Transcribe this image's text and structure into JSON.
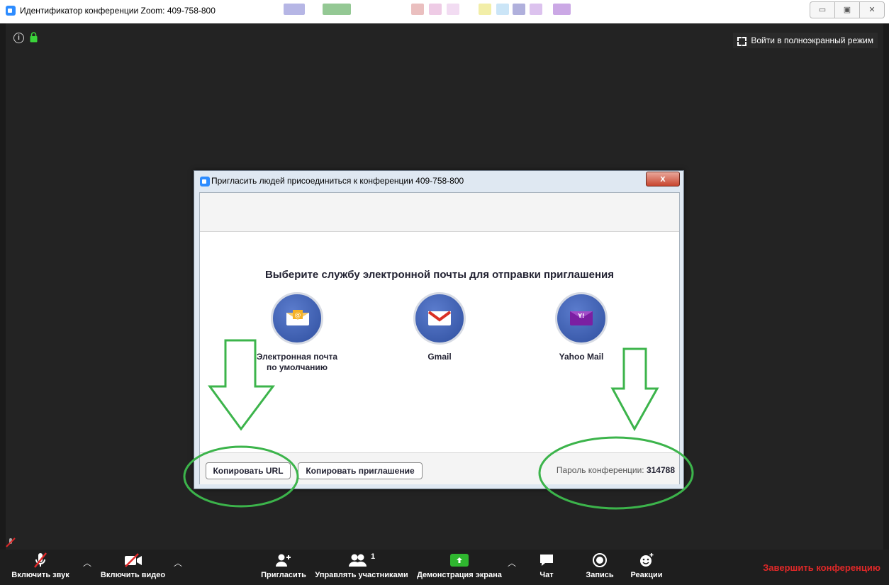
{
  "window": {
    "title": "Идентификатор конференции Zoom: 409-758-800",
    "controls": [
      "minimize",
      "maximize",
      "close"
    ]
  },
  "meeting": {
    "fullscreen_label": "Войти в полноэкранный режим"
  },
  "dialog": {
    "title": "Пригласить людей присоединиться к конференции 409-758-800",
    "close_glyph": "x",
    "heading": "Выберите службу электронной почты для отправки приглашения",
    "services": [
      {
        "label_line1": "Электронная почта",
        "label_line2": "по умолчанию",
        "icon": "default-mail-icon"
      },
      {
        "label_line1": "Gmail",
        "label_line2": "",
        "icon": "gmail-icon"
      },
      {
        "label_line1": "Yahoo Mail",
        "label_line2": "",
        "icon": "yahoo-mail-icon"
      }
    ],
    "copy_url_label": "Копировать URL",
    "copy_invite_label": "Копировать приглашение",
    "password_label": "Пароль конференции:",
    "password_value": "314788"
  },
  "toolbar": {
    "unmute": "Включить звук",
    "start_video": "Включить видео",
    "invite": "Пригласить",
    "participants": "Управлять участниками",
    "participants_count": "1",
    "share": "Демонстрация экрана",
    "chat": "Чат",
    "record": "Запись",
    "reactions": "Реакции",
    "end": "Завершить конференцию"
  },
  "colors": {
    "accent": "#2d8cff",
    "share_green": "#2fb62f",
    "end_red": "#e02828",
    "annotation_green": "#3cb44b"
  }
}
